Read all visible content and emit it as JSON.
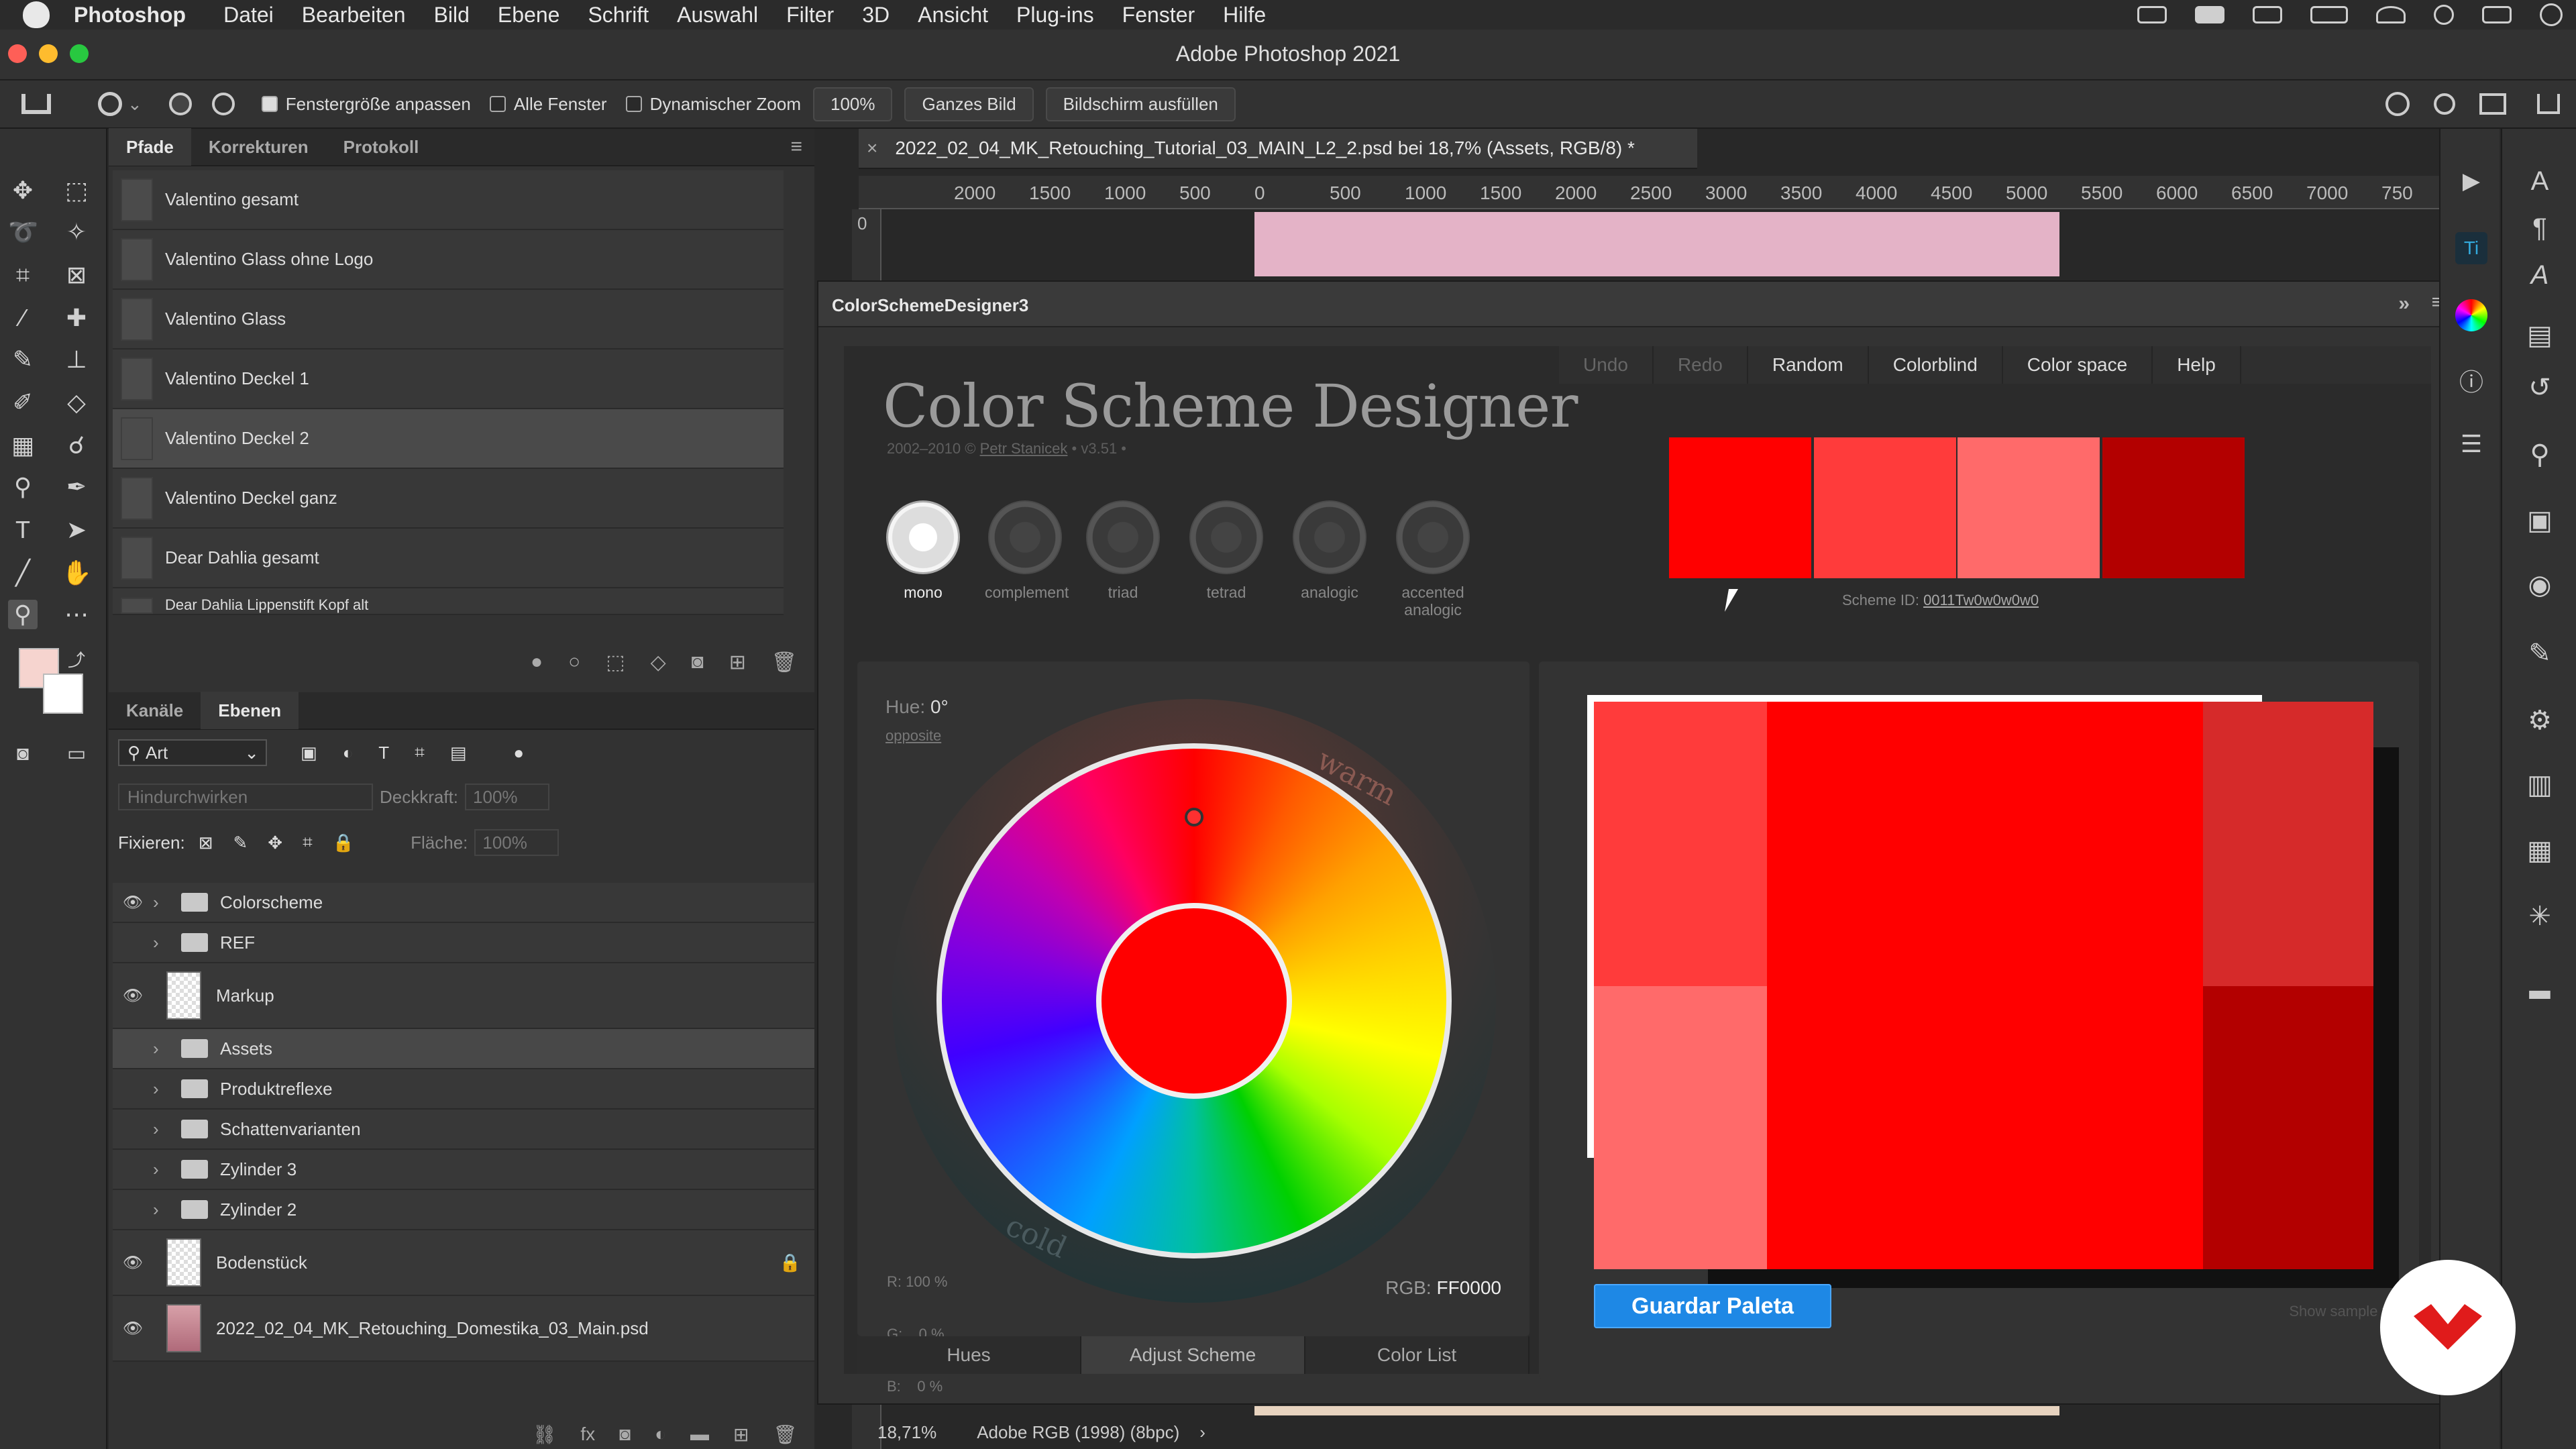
{
  "menubar": {
    "app": "Photoshop",
    "items": [
      "Datei",
      "Bearbeiten",
      "Bild",
      "Ebene",
      "Schrift",
      "Auswahl",
      "Filter",
      "3D",
      "Ansicht",
      "Plug-ins",
      "Fenster",
      "Hilfe"
    ]
  },
  "window": {
    "title": "Adobe Photoshop 2021"
  },
  "options": {
    "fit_window": "Fenstergröße anpassen",
    "all_windows": "Alle Fenster",
    "dynamic_zoom": "Dynamischer Zoom",
    "zoom_value": "100%",
    "whole_image": "Ganzes Bild",
    "fill_screen": "Bildschirm ausfüllen"
  },
  "paths_panel": {
    "tabs": [
      "Pfade",
      "Korrekturen",
      "Protokoll"
    ],
    "items": [
      "Valentino gesamt",
      "Valentino Glass ohne Logo",
      "Valentino Glass",
      "Valentino Deckel 1",
      "Valentino Deckel 2",
      "Valentino Deckel ganz",
      "Dear Dahlia gesamt",
      "Dear Dahlia Lippenstift Kopf alt"
    ]
  },
  "layers_panel": {
    "tabs": [
      "Kanäle",
      "Ebenen"
    ],
    "filter": "Art",
    "blend_mode": "Hindurchwirken",
    "opacity_label": "Deckkraft:",
    "opacity_value": "100%",
    "lock_label": "Fixieren:",
    "fill_label": "Fläche:",
    "fill_value": "100%",
    "layers": [
      {
        "name": "Colorscheme",
        "type": "group",
        "visible": true
      },
      {
        "name": "REF",
        "type": "group",
        "visible": false
      },
      {
        "name": "Markup",
        "type": "layer",
        "visible": true
      },
      {
        "name": "Assets",
        "type": "group",
        "visible": false
      },
      {
        "name": "Produktreflexe",
        "type": "group",
        "visible": false
      },
      {
        "name": "Schattenvarianten",
        "type": "group",
        "visible": false
      },
      {
        "name": "Zylinder 3",
        "type": "group",
        "visible": false
      },
      {
        "name": "Zylinder 2",
        "type": "group",
        "visible": false
      },
      {
        "name": "Bodenstück",
        "type": "layer",
        "visible": true
      },
      {
        "name": "2022_02_04_MK_Retouching_Domestika_03_Main.psd",
        "type": "smart",
        "visible": true
      }
    ]
  },
  "document": {
    "tab_title": "2022_02_04_MK_Retouching_Tutorial_03_MAIN_L2_2.psd bei 18,7% (Assets, RGB/8) *",
    "ruler_ticks": [
      "2000",
      "1500",
      "1000",
      "500",
      "0",
      "500",
      "1000",
      "1500",
      "2000",
      "2500",
      "3000",
      "3500",
      "4000",
      "4500",
      "5000",
      "5500",
      "6000",
      "6500",
      "7000",
      "750"
    ],
    "vruler_first": "0",
    "zoom": "18,71%",
    "profile": "Adobe RGB (1998) (8bpc)"
  },
  "plugin": {
    "title": "ColorSchemeDesigner3",
    "menu": [
      "Undo",
      "Redo",
      "Random",
      "Colorblind",
      "Color space",
      "Help"
    ],
    "app_title": "Color Scheme Designer",
    "credit_prefix": "2002–2010 ©",
    "credit_author": "Petr Stanicek",
    "credit_version": "• v3.51 •",
    "modes": [
      "mono",
      "complement",
      "triad",
      "tetrad",
      "analogic",
      "accented analogic"
    ],
    "swatches": [
      "#FF0000",
      "#FF3B3B",
      "#FF6A6A",
      "#B30000"
    ],
    "scheme_id_label": "Scheme ID:",
    "scheme_id": "0011Tw0w0w0w0",
    "hue_label": "Hue:",
    "hue_value": "0°",
    "opposite": "opposite",
    "warm": "warm",
    "cold": "cold",
    "rgb_r": "R: 100 %",
    "rgb_g": "G:    0 %",
    "rgb_b": "B:    0 %",
    "rgb_hex_label": "RGB:",
    "rgb_hex": "FF0000",
    "bottom_tabs": [
      "Hues",
      "Adjust Scheme",
      "Color List"
    ],
    "save_button": "Guardar Paleta",
    "sample_text": "Show sample text"
  },
  "colors": {
    "primary": "#FF0000",
    "light": "#FF3B3B",
    "lighter": "#FF6A6A",
    "dark": "#B30000",
    "accent_button": "#1E88E5"
  }
}
